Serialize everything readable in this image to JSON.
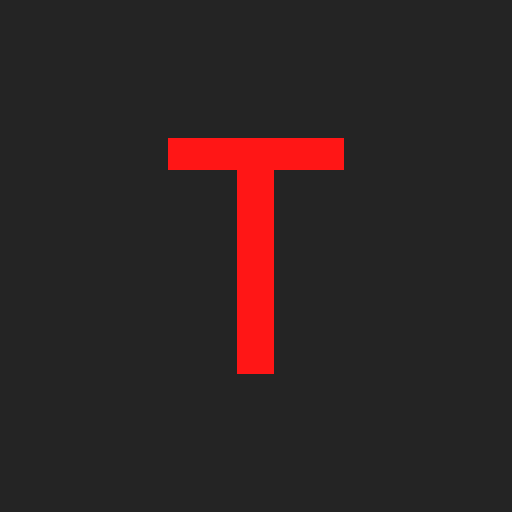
{
  "background_color": "#242424",
  "glyph": {
    "char": "T",
    "color": "#ff1616"
  }
}
